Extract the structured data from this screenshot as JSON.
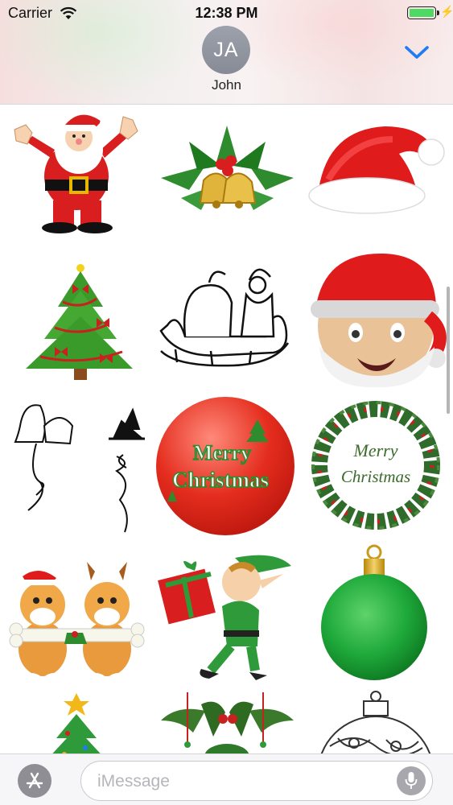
{
  "status_bar": {
    "carrier": "Carrier",
    "time": "12:38 PM",
    "battery_level": 1.0,
    "icons": [
      "wifi-icon",
      "battery-icon",
      "charging-bolt-icon"
    ]
  },
  "conversation": {
    "contact_initials": "JA",
    "contact_name": "John",
    "collapse_icon": "chevron-down-icon",
    "accent_color": "#1f7cf5"
  },
  "stickers": [
    {
      "id": "santa-waving"
    },
    {
      "id": "holly-bells"
    },
    {
      "id": "santa-hat"
    },
    {
      "id": "christmas-tree"
    },
    {
      "id": "santa-sleigh-outline"
    },
    {
      "id": "santa-emoji-face"
    },
    {
      "id": "bells-outline"
    },
    {
      "id": "merry-christmas-ball",
      "text_line1": "Merry",
      "text_line2": "Christmas"
    },
    {
      "id": "merry-christmas-wreath",
      "text_line1": "Merry",
      "text_line2": "Christmas"
    },
    {
      "id": "puppies-with-bone"
    },
    {
      "id": "elf-with-gift"
    },
    {
      "id": "green-ornament"
    },
    {
      "id": "small-tree"
    },
    {
      "id": "holly-ornament"
    },
    {
      "id": "ornament-outline"
    }
  ],
  "input_bar": {
    "app_store_icon": "app-store-icon",
    "placeholder": "iMessage",
    "mic_icon": "microphone-icon"
  }
}
